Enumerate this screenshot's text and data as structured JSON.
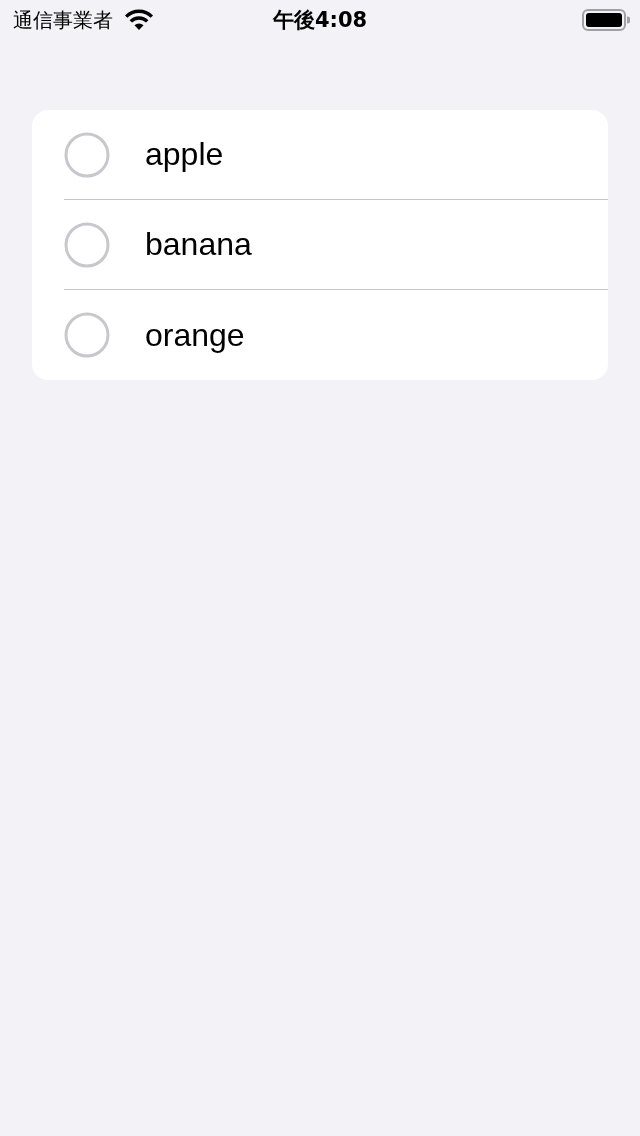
{
  "status_bar": {
    "carrier": "通信事業者",
    "time": "午後4:08"
  },
  "list": {
    "items": [
      {
        "label": "apple",
        "checked": false
      },
      {
        "label": "banana",
        "checked": false
      },
      {
        "label": "orange",
        "checked": false
      }
    ]
  }
}
